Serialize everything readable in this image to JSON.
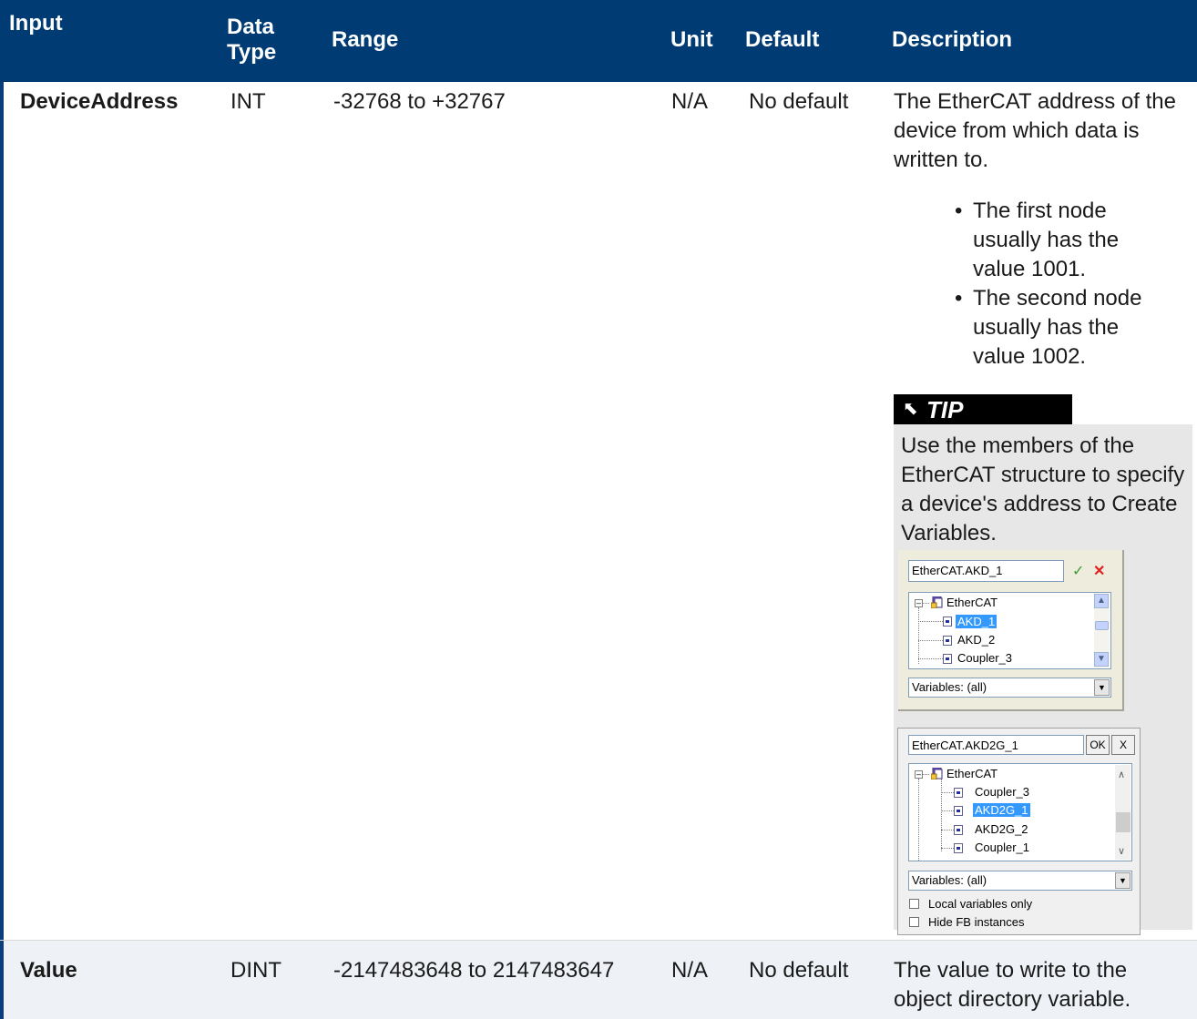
{
  "headers": {
    "input": "Input",
    "data_type": "Data Type",
    "range": "Range",
    "unit": "Unit",
    "default": "Default",
    "description": "Description"
  },
  "rows": [
    {
      "input": "DeviceAddress",
      "data_type": "INT",
      "range": "-32768 to +32767",
      "unit": "N/A",
      "default": "No default",
      "description": "The EtherCAT address of the device from which data is written to.",
      "bullets": [
        "The first node usually has the value 1001.",
        "The second node usually has the value 1002."
      ],
      "tip": {
        "label": "TIP",
        "icon": "pin-icon",
        "text": "Use the members of the EtherCAT structure to specify a device's address to Create Variables."
      }
    },
    {
      "input": "Value",
      "data_type": "DINT",
      "range": "-2147483648 to 2147483647",
      "unit": "N/A",
      "default": "No default",
      "description": "The value to write to the object directory variable."
    }
  ],
  "dialog1": {
    "input_value": "EtherCAT.AKD_1",
    "root": "EtherCAT",
    "items": [
      "AKD_1",
      "AKD_2",
      "Coupler_3"
    ],
    "selected": "AKD_1",
    "filter": "Variables: (all)"
  },
  "dialog2": {
    "input_value": "EtherCAT.AKD2G_1",
    "ok_label": "OK",
    "close_label": "X",
    "root": "EtherCAT",
    "items": [
      "Coupler_3",
      "AKD2G_1",
      "AKD2G_2",
      "Coupler_1"
    ],
    "selected": "AKD2G_1",
    "filter": "Variables: (all)",
    "checkbox_local": "Local variables only",
    "checkbox_hide": "Hide FB instances"
  },
  "colors": {
    "header_bg": "#003b73",
    "row_alt_bg": "#eef2f7",
    "tip_bg": "#e7e7e7",
    "selection": "#3399ff"
  }
}
